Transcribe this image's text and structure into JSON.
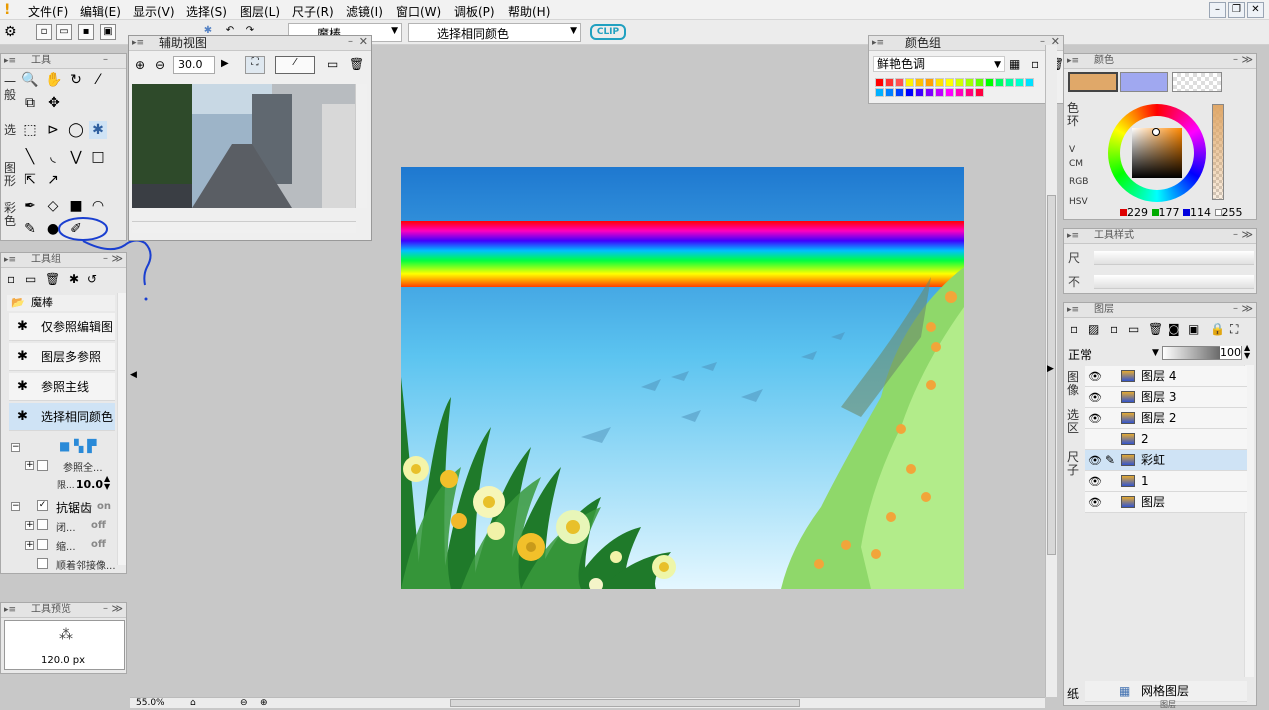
{
  "menu": {
    "items": [
      "文件(F)",
      "编辑(E)",
      "显示(V)",
      "选择(S)",
      "图层(L)",
      "尺子(R)",
      "滤镜(I)",
      "窗口(W)",
      "调板(P)",
      "帮助(H)"
    ]
  },
  "toolbar": {
    "tool_select": "魔棒",
    "mode_select": "选择相同颜色",
    "clip_logo": "CLIP"
  },
  "tools_panel": {
    "title": "工具",
    "side_labels": [
      "一般",
      "选",
      "图形",
      "彩色"
    ]
  },
  "subview": {
    "title": "辅助视图",
    "zoom": "30.0"
  },
  "colorset": {
    "title": "颜色组",
    "set_name": "鲜艳色调",
    "colors": [
      "#ff0000",
      "#ff3030",
      "#ff5050",
      "#fff200",
      "#ffc000",
      "#ffa000",
      "#ffe000",
      "#ffff00",
      "#d0ff00",
      "#a0ff00",
      "#60ff00",
      "#00ff00",
      "#00ff60",
      "#00ffa0",
      "#00ffd0",
      "#00e0ff",
      "#00b0ff",
      "#0080ff",
      "#0040ff",
      "#0000ff",
      "#4000ff",
      "#8000ff",
      "#c000ff",
      "#ff00ff",
      "#ff00c0",
      "#ff0080",
      "#ff0040"
    ]
  },
  "toolgroup": {
    "title": "工具组",
    "folder": "魔棒",
    "tools": [
      "仅参照编辑图",
      "图层多参照",
      "参照主线",
      "选择相同颜色"
    ],
    "props": {
      "ref_label": "参照全...",
      "tolerance_label": "限...",
      "tolerance": "10.0",
      "antialias_label": "抗锯齿",
      "antialias_val": "on",
      "row3_label": "闭...",
      "row3_val": "off",
      "row4_label": "缩...",
      "row4_val": "off",
      "row5_label": "顺着邻接像..."
    }
  },
  "toolpreview": {
    "title": "工具预览",
    "size": "120.0 px"
  },
  "status": {
    "zoom": "55.0%"
  },
  "color_panel": {
    "title": "颜色",
    "ring_label": "色环",
    "side_tabs": [
      "V",
      "CM",
      "RGB",
      "HSV"
    ],
    "main_color": "#e0a869",
    "sub_color": "#a0a8f0",
    "r": "229",
    "g": "177",
    "b": "114",
    "opacity": "255"
  },
  "toolstyle": {
    "title": "工具样式",
    "row1": "尺",
    "row2": "不"
  },
  "layers": {
    "title": "图层",
    "blend": "正常",
    "opacity": "100",
    "side_tabs": [
      "图像",
      "选区",
      "尺子"
    ],
    "items": [
      {
        "name": "图层 4",
        "visible": true,
        "selected": false
      },
      {
        "name": "图层 3",
        "visible": true,
        "selected": false
      },
      {
        "name": "图层 2",
        "visible": true,
        "selected": false
      },
      {
        "name": "2",
        "visible": false,
        "selected": false
      },
      {
        "name": "彩虹",
        "visible": true,
        "selected": true
      },
      {
        "name": "1",
        "visible": true,
        "selected": false
      },
      {
        "name": "图层",
        "visible": true,
        "selected": false
      }
    ],
    "paper_tab": "纸",
    "grid_layer": "网格图层",
    "bottom_label": "图层"
  }
}
